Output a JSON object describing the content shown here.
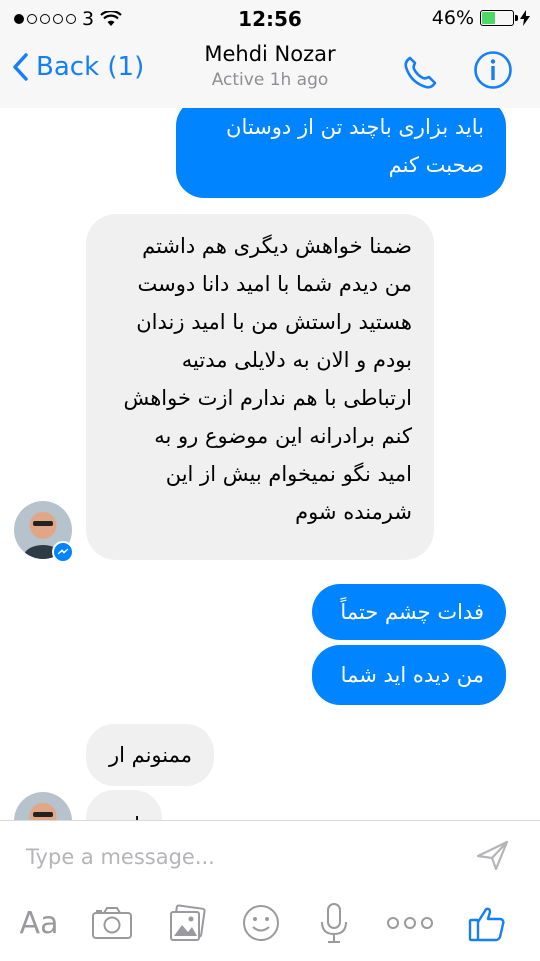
{
  "status_bar": {
    "carrier": "3",
    "time": "12:56",
    "battery_percent": "46%",
    "battery_level": 0.46
  },
  "nav": {
    "back_label": "Back (1)",
    "contact_name": "Mehdi Nozar",
    "contact_status": "Active 1h ago"
  },
  "messages": [
    {
      "direction": "outgoing",
      "lines": [
        "باید بزاری باچند تن از دوستان",
        "صحبت کنم"
      ]
    },
    {
      "direction": "incoming",
      "lines": [
        "ضمنا خواهش دیگری هم داشتم",
        "من دیدم شما با امید دانا دوست",
        "هستید راستش من با امید زندان",
        "بودم و الان به دلایلی مدتیه",
        "ارتباطی با هم ندارم ازت خواهش",
        "کنم برادرانه این موضوع رو به",
        "امید نگو نمیخوام بیش از این",
        "شرمنده شوم"
      ]
    },
    {
      "direction": "outgoing",
      "lines": [
        "فدات چشم حتماً"
      ]
    },
    {
      "direction": "outgoing",
      "lines": [
        "من دیده اید شما"
      ]
    },
    {
      "direction": "incoming",
      "lines": [
        "ممنونم ار"
      ]
    },
    {
      "direction": "incoming",
      "lines": [
        "ازت"
      ]
    }
  ],
  "composer": {
    "placeholder": "Type a message...",
    "text_tool_label": "Aa",
    "icons": [
      "camera-icon",
      "photo-gallery-icon",
      "emoji-icon",
      "microphone-icon",
      "more-icon",
      "like-icon"
    ]
  },
  "colors": {
    "accent": "#0084ff",
    "ios_blue": "#147efb",
    "incoming_bubble": "#f1f0f0"
  }
}
